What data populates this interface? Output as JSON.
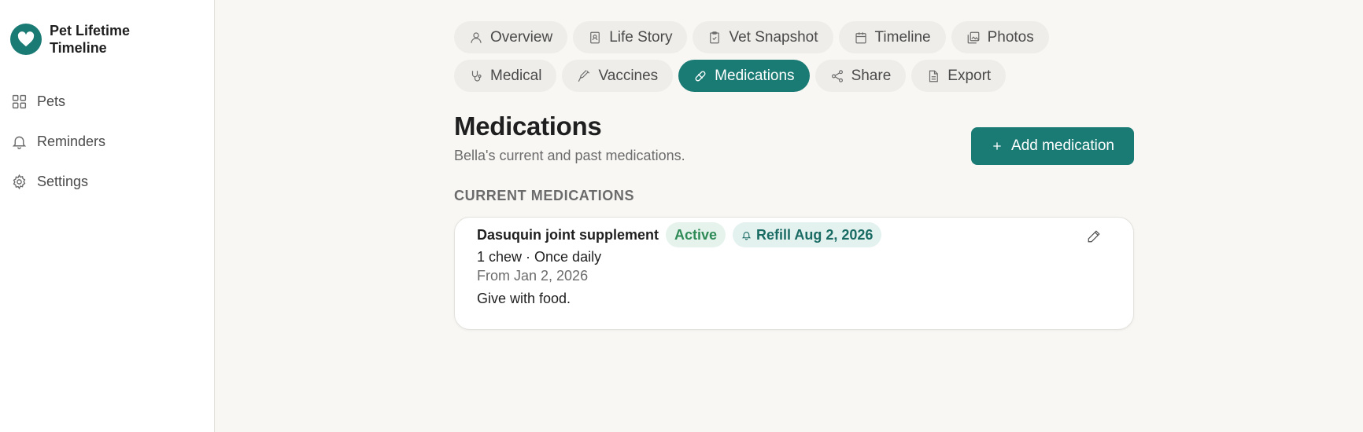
{
  "app": {
    "title": "Pet Lifetime Timeline"
  },
  "sidebar": {
    "items": [
      {
        "label": "Pets",
        "icon": "grid-icon"
      },
      {
        "label": "Reminders",
        "icon": "bell-icon"
      },
      {
        "label": "Settings",
        "icon": "gear-icon"
      }
    ]
  },
  "tabs": [
    {
      "label": "Overview",
      "icon": "user-icon",
      "active": false
    },
    {
      "label": "Life Story",
      "icon": "book-icon",
      "active": false
    },
    {
      "label": "Vet Snapshot",
      "icon": "clipboard-icon",
      "active": false
    },
    {
      "label": "Timeline",
      "icon": "calendar-icon",
      "active": false
    },
    {
      "label": "Photos",
      "icon": "images-icon",
      "active": false
    },
    {
      "label": "Medical",
      "icon": "stethoscope-icon",
      "active": false
    },
    {
      "label": "Vaccines",
      "icon": "syringe-icon",
      "active": false
    },
    {
      "label": "Medications",
      "icon": "pill-icon",
      "active": true
    },
    {
      "label": "Share",
      "icon": "share-icon",
      "active": false
    },
    {
      "label": "Export",
      "icon": "file-icon",
      "active": false
    }
  ],
  "page": {
    "title": "Medications",
    "subtitle": "Bella's current and past medications.",
    "add_button_label": "Add medication",
    "section_title": "CURRENT MEDICATIONS"
  },
  "medications": [
    {
      "name": "Dasuquin joint supplement",
      "status": "Active",
      "refill": "Refill Aug 2, 2026",
      "dose": "1 chew · Once daily",
      "since": "From Jan 2, 2026",
      "notes": "Give with food."
    }
  ],
  "colors": {
    "accent": "#1a7a74",
    "background": "#f8f7f4",
    "active_badge_bg": "#e6f3ec",
    "active_badge_text": "#2e8a56",
    "refill_badge_bg": "#e3f1ef"
  }
}
